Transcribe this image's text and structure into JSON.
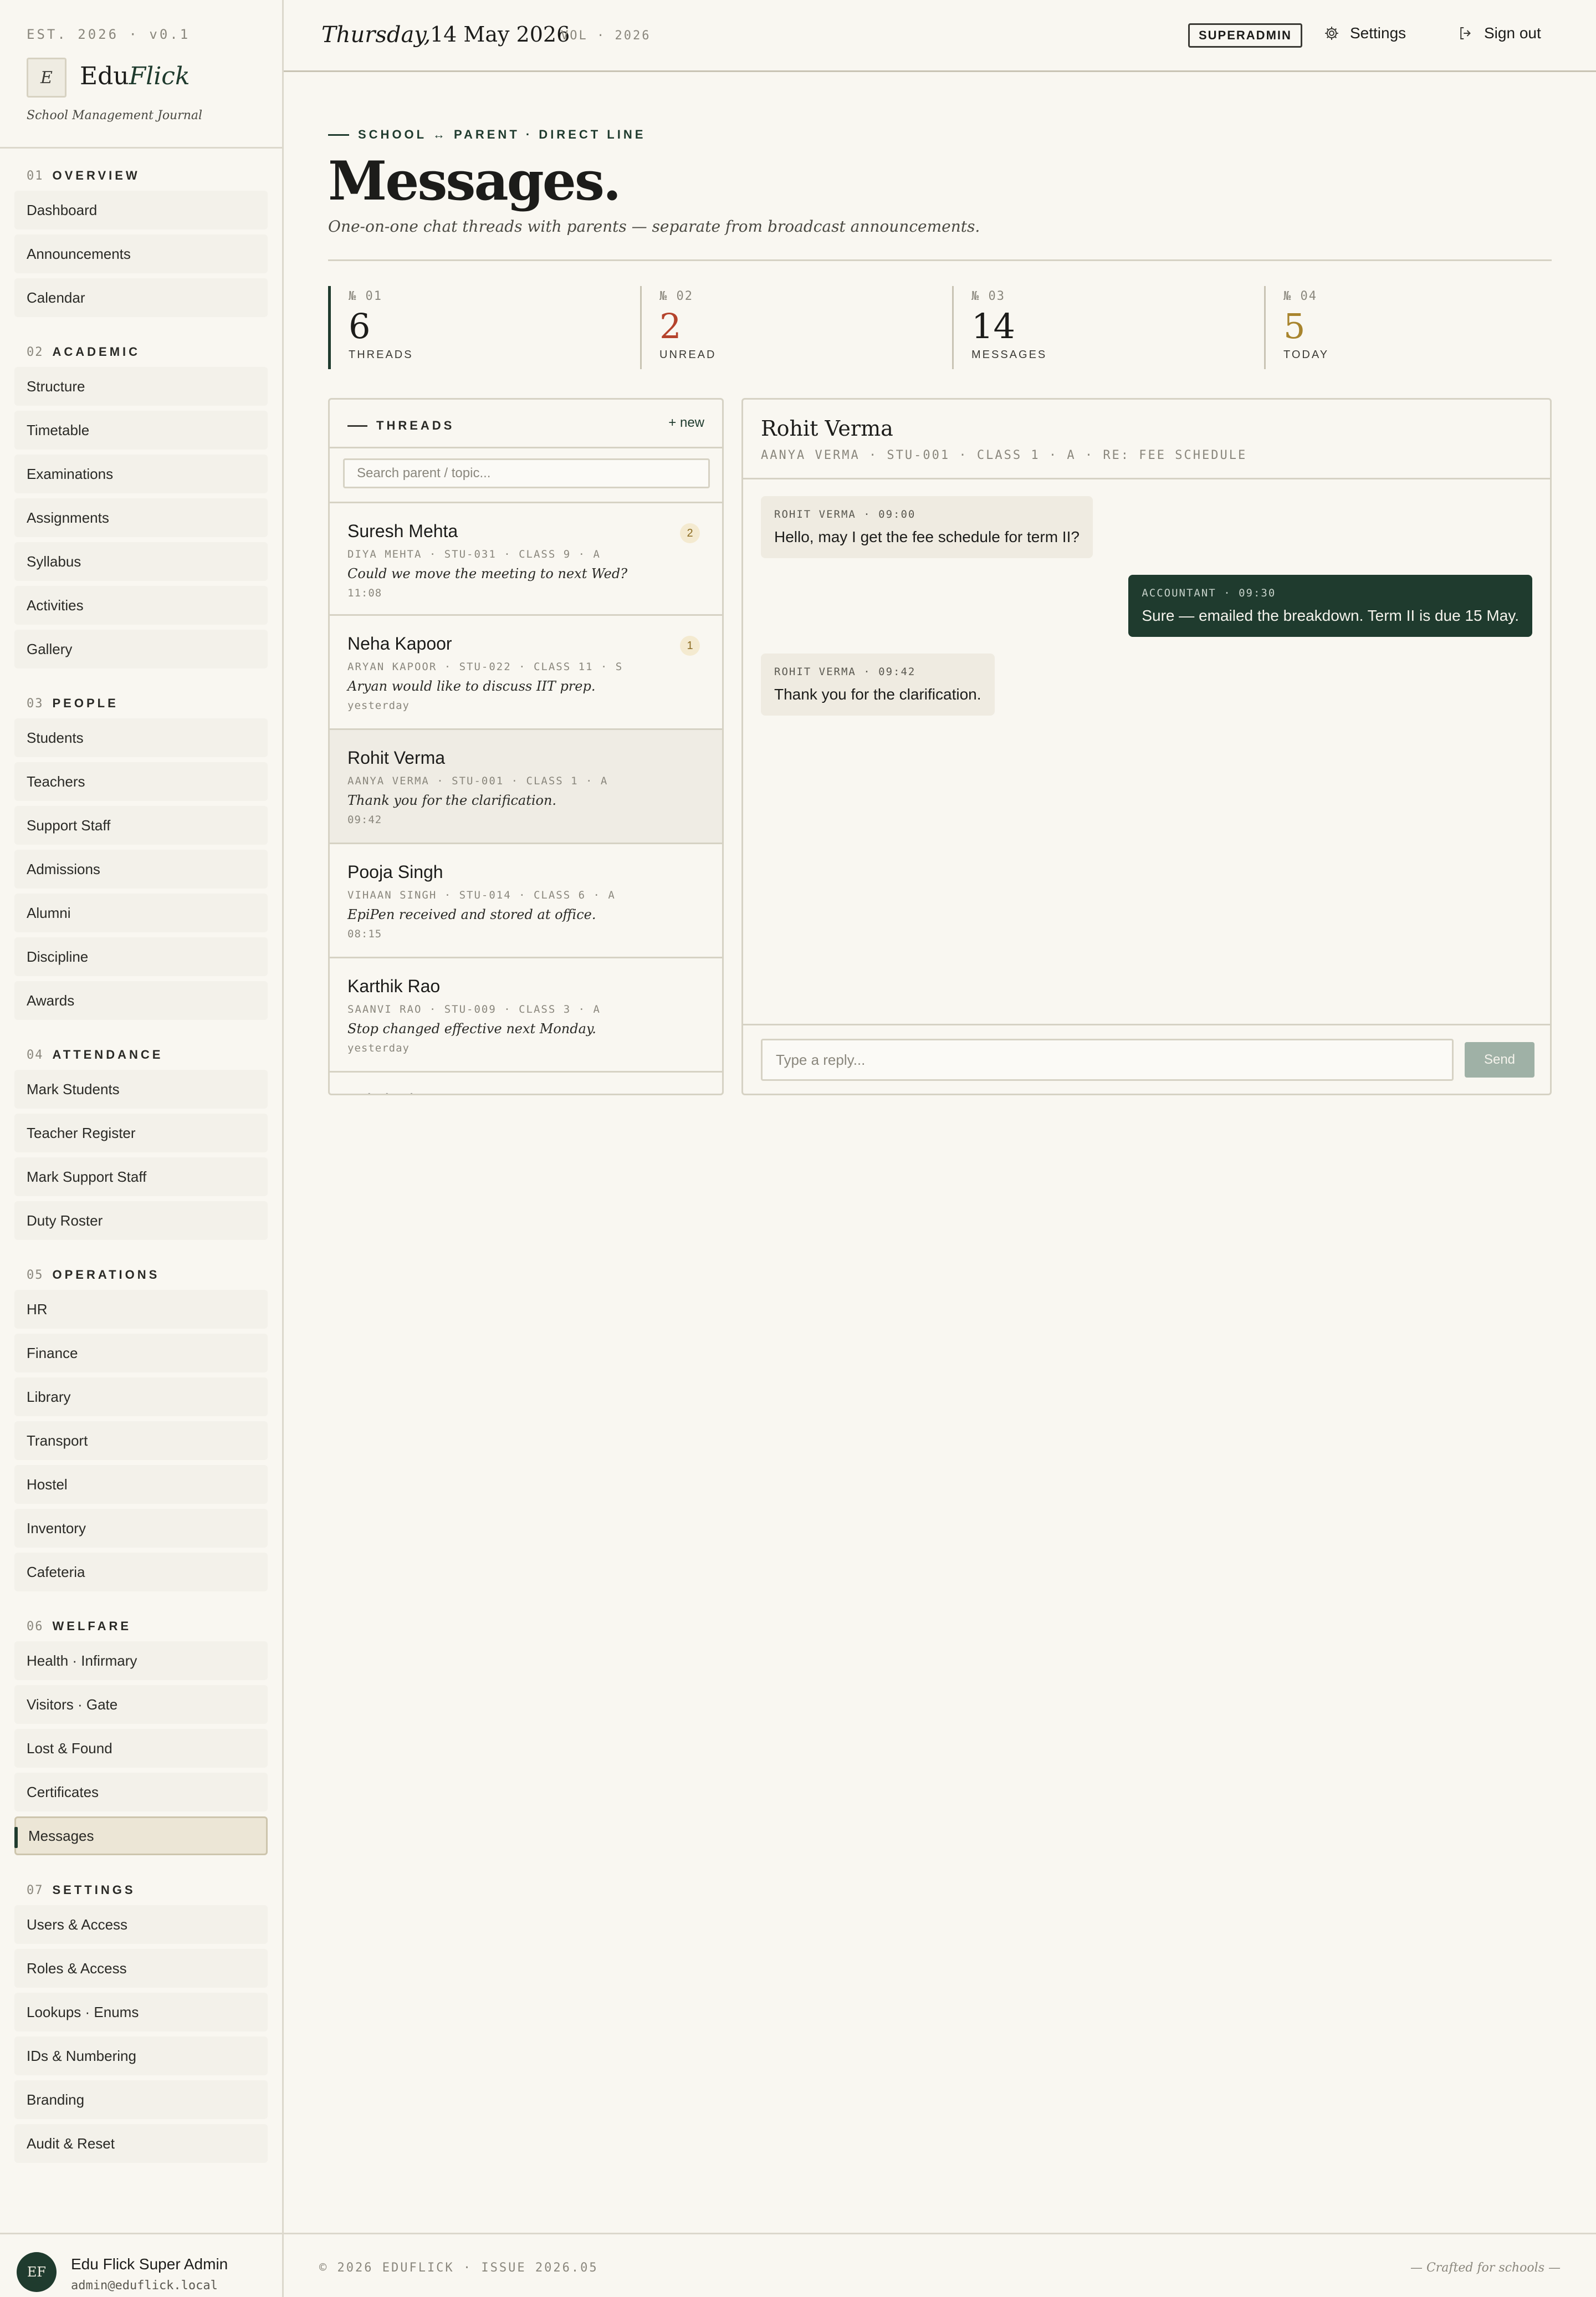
{
  "brand": {
    "est": "EST. 2026 · v0.1",
    "logo_letter": "E",
    "name_plain": "Edu",
    "name_accent": "Flick",
    "tagline": "School Management Journal"
  },
  "sidebar": {
    "sections": [
      {
        "num": "01",
        "title": "OVERVIEW",
        "items": [
          "Dashboard",
          "Announcements",
          "Calendar"
        ]
      },
      {
        "num": "02",
        "title": "ACADEMIC",
        "items": [
          "Structure",
          "Timetable",
          "Examinations",
          "Assignments",
          "Syllabus",
          "Activities",
          "Gallery"
        ]
      },
      {
        "num": "03",
        "title": "PEOPLE",
        "items": [
          "Students",
          "Teachers",
          "Support Staff",
          "Admissions",
          "Alumni",
          "Discipline",
          "Awards"
        ]
      },
      {
        "num": "04",
        "title": "ATTENDANCE",
        "items": [
          "Mark Students",
          "Teacher Register",
          "Mark Support Staff",
          "Duty Roster"
        ]
      },
      {
        "num": "05",
        "title": "OPERATIONS",
        "items": [
          "HR",
          "Finance",
          "Library",
          "Transport",
          "Hostel",
          "Inventory",
          "Cafeteria"
        ]
      },
      {
        "num": "06",
        "title": "WELFARE",
        "items": [
          "Health · Infirmary",
          "Visitors · Gate",
          "Lost & Found",
          "Certificates",
          "Messages"
        ]
      },
      {
        "num": "07",
        "title": "SETTINGS",
        "items": [
          "Users & Access",
          "Roles & Access",
          "Lookups · Enums",
          "IDs & Numbering",
          "Branding",
          "Audit & Reset"
        ]
      }
    ],
    "active_item": "Messages"
  },
  "user": {
    "initials": "EF",
    "name": "Edu Flick Super Admin",
    "email": "admin@eduflick.local"
  },
  "topbar": {
    "day": "Thursday,",
    "date": "14 May 2026",
    "vol": "VOL · 2026",
    "role": "SUPERADMIN",
    "settings_label": "Settings",
    "signout_label": "Sign out"
  },
  "page": {
    "kicker": "SCHOOL ↔ PARENT · DIRECT LINE",
    "title": "Messages.",
    "subtitle": "One-on-one chat threads with parents — separate from broadcast announcements."
  },
  "stats": [
    {
      "idx": "№ 01",
      "value": "6",
      "label": "THREADS",
      "color": "#1c1c1a"
    },
    {
      "idx": "№ 02",
      "value": "2",
      "label": "UNREAD",
      "color": "#b5432c"
    },
    {
      "idx": "№ 03",
      "value": "14",
      "label": "MESSAGES",
      "color": "#1c1c1a"
    },
    {
      "idx": "№ 04",
      "value": "5",
      "label": "TODAY",
      "color": "#a8842d"
    }
  ],
  "threads": {
    "title": "THREADS",
    "new_label": "+ new",
    "search_placeholder": "Search parent / topic...",
    "items": [
      {
        "name": "Suresh Mehta",
        "meta": "DIYA MEHTA · STU-031 · CLASS 9 · A",
        "preview": "Could we move the meeting to next Wed?",
        "time": "11:08",
        "unread": "2"
      },
      {
        "name": "Neha Kapoor",
        "meta": "ARYAN KAPOOR · STU-022 · CLASS 11 · S",
        "preview": "Aryan would like to discuss IIT prep.",
        "time": "yesterday",
        "unread": "1"
      },
      {
        "name": "Rohit Verma",
        "meta": "AANYA VERMA · STU-001 · CLASS 1 · A",
        "preview": "Thank you for the clarification.",
        "time": "09:42",
        "unread": ""
      },
      {
        "name": "Pooja Singh",
        "meta": "VIHAAN SINGH · STU-014 · CLASS 6 · A",
        "preview": "EpiPen received and stored at office.",
        "time": "08:15",
        "unread": ""
      },
      {
        "name": "Karthik Rao",
        "meta": "SAANVI RAO · STU-009 · CLASS 3 · A",
        "preview": "Stop changed effective next Monday.",
        "time": "yesterday",
        "unread": ""
      },
      {
        "name": "Lakshmi Iyer",
        "meta": "",
        "preview": "",
        "time": "",
        "unread": ""
      }
    ]
  },
  "chat": {
    "name": "Rohit Verma",
    "meta": "AANYA VERMA · STU-001 · CLASS 1 · A · RE: FEE SCHEDULE",
    "messages": [
      {
        "dir": "in",
        "header": "ROHIT VERMA · 09:00",
        "text": "Hello, may I get the fee schedule for term II?"
      },
      {
        "dir": "out",
        "header": "ACCOUNTANT · 09:30",
        "text": "Sure — emailed the breakdown. Term II is due 15 May."
      },
      {
        "dir": "in",
        "header": "ROHIT VERMA · 09:42",
        "text": "Thank you for the clarification."
      }
    ],
    "reply_placeholder": "Type a reply...",
    "send_label": "Send"
  },
  "footer": {
    "copy": "© 2026 EDUFLICK · ISSUE 2026.05",
    "crafted": "— Crafted for schools —"
  },
  "colors": {
    "accent": "#1f3b2e",
    "unread": "#b5432c",
    "today": "#a8842d",
    "background": "#f9f7f1"
  },
  "icons": {
    "settings": "gear-icon",
    "signout": "sign-out-icon"
  }
}
